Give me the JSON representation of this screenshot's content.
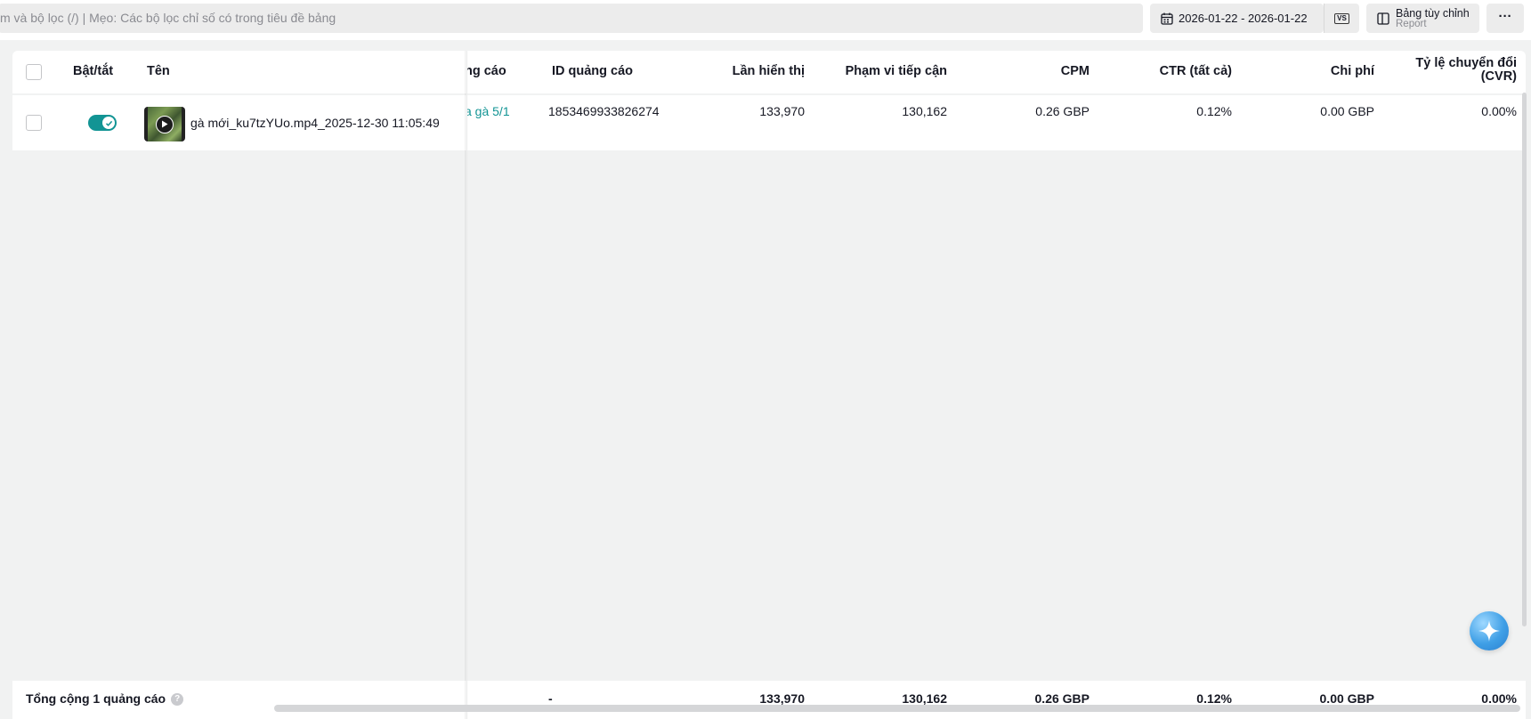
{
  "toolbar": {
    "search_placeholder": "m và bộ lọc (/) | Mẹo: Các bộ lọc chỉ số có trong tiêu đề bảng",
    "date_range": "2026-01-22 - 2026-01-22",
    "compare_label": "VS",
    "custom_table_label": "Bảng tùy chỉnh",
    "custom_table_sub": "Report",
    "more_label": "···"
  },
  "table": {
    "headers": {
      "toggle": "Bật/tắt",
      "name": "Tên",
      "ad_group": "ng cáo",
      "ad_id": "ID quảng cáo",
      "impressions": "Lần hiển thị",
      "reach": "Phạm vi tiếp cận",
      "cpm": "CPM",
      "ctr": "CTR (tất cả)",
      "cost": "Chi phí",
      "cvr_line1": "Tỷ lệ chuyển đổi",
      "cvr_line2": "(CVR)"
    },
    "rows": [
      {
        "name": "gà mới_ku7tzYUo.mp4_2025-12-30 11:05:49",
        "ad_group": "a gà 5/1",
        "ad_id": "1853469933826274",
        "impressions": "133,970",
        "reach": "130,162",
        "cpm": "0.26 GBP",
        "ctr": "0.12%",
        "cost": "0.00 GBP",
        "cvr": "0.00%",
        "enabled": true
      }
    ],
    "totals": {
      "label": "Tổng cộng 1 quảng cáo",
      "ad_id": "-",
      "impressions": "133,970",
      "reach": "130,162",
      "cpm": "0.26 GBP",
      "ctr": "0.12%",
      "cost": "0.00 GBP",
      "cvr": "0.00%"
    }
  },
  "colors": {
    "accent": "#129494",
    "link": "#129494"
  }
}
